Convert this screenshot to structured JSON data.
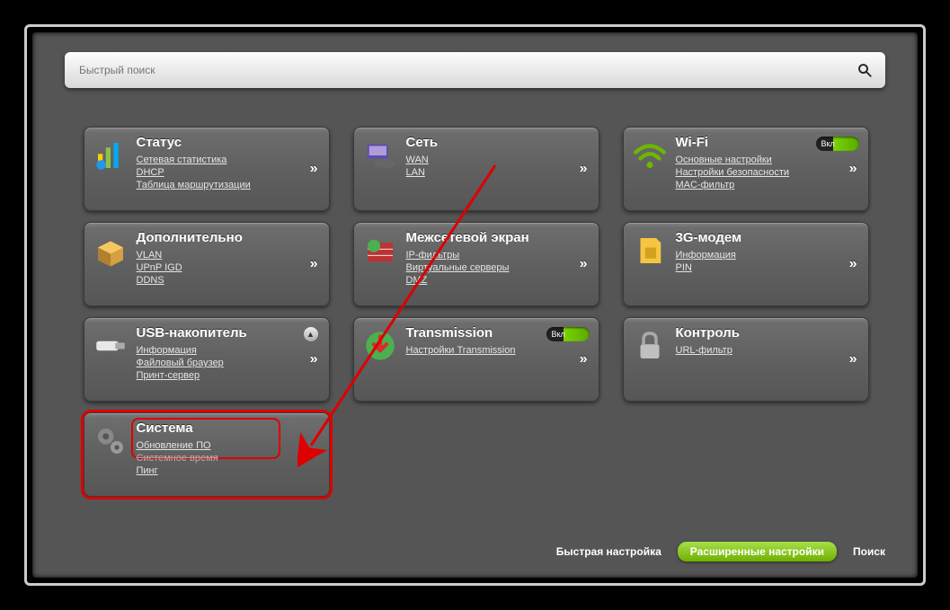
{
  "search": {
    "placeholder": "Быстрый поиск"
  },
  "cards": [
    {
      "title": "Статус",
      "links": [
        "Сетевая статистика",
        "DHCP",
        "Таблица маршрутизации"
      ],
      "arrow": true
    },
    {
      "title": "Сеть",
      "links": [
        "WAN",
        "LAN"
      ],
      "arrow": true
    },
    {
      "title": "Wi-Fi",
      "links": [
        "Основные настройки",
        "Настройки безопасности",
        "MAC-фильтр"
      ],
      "arrow": true,
      "toggle": "Вкл"
    },
    {
      "title": "Дополнительно",
      "links": [
        "VLAN",
        "UPnP IGD",
        "DDNS"
      ],
      "arrow": true
    },
    {
      "title": "Межсетевой экран",
      "links": [
        "IP-фильтры",
        "Виртуальные серверы",
        "DMZ"
      ],
      "arrow": true
    },
    {
      "title": "3G-модем",
      "links": [
        "Информация",
        "PIN"
      ],
      "arrow": true
    },
    {
      "title": "USB-накопитель",
      "links": [
        "Информация",
        "Файловый браузер",
        "Принт-сервер"
      ],
      "arrow": true,
      "eject": true
    },
    {
      "title": "Transmission",
      "links": [
        "Настройки Transmission"
      ],
      "arrow": true,
      "toggle": "Вкл"
    },
    {
      "title": "Контроль",
      "links": [
        "URL-фильтр"
      ],
      "arrow": true
    },
    {
      "title": "Система",
      "links": [
        "Обновление ПО",
        "Системное время",
        "Пинг"
      ],
      "arrow": true,
      "hl": true
    }
  ],
  "footer": {
    "quick": "Быстрая настройка",
    "extended": "Расширенные настройки",
    "search": "Поиск"
  }
}
